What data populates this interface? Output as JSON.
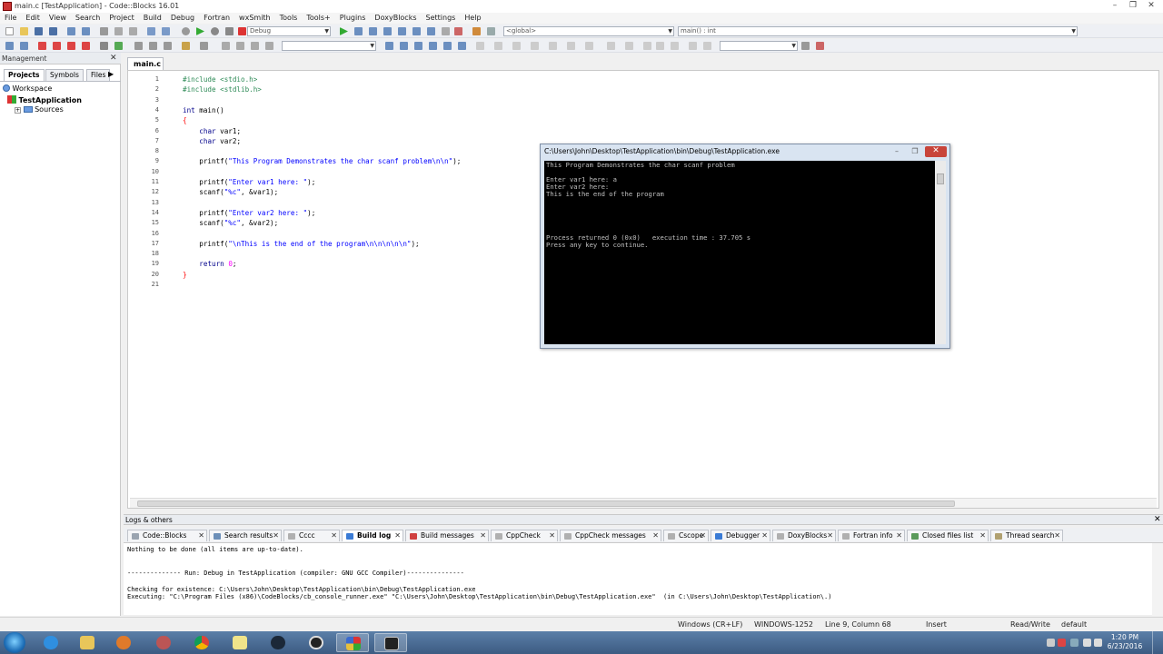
{
  "window": {
    "title": "main.c [TestApplication] - Code::Blocks 16.01"
  },
  "menu": [
    "File",
    "Edit",
    "View",
    "Search",
    "Project",
    "Build",
    "Debug",
    "Fortran",
    "wxSmith",
    "Tools",
    "Tools+",
    "Plugins",
    "DoxyBlocks",
    "Settings",
    "Help"
  ],
  "toolbar": {
    "build_target": "Debug",
    "scope": "<global>",
    "symbol": "main() : int"
  },
  "management": {
    "title": "Management",
    "tabs": [
      "Projects",
      "Symbols",
      "Files"
    ],
    "workspace": "Workspace",
    "project": "TestApplication",
    "folder": "Sources"
  },
  "editor": {
    "tab": "main.c",
    "lines": [
      {
        "n": "1",
        "segments": [
          {
            "c": "pp",
            "t": "#include <stdio.h>"
          }
        ]
      },
      {
        "n": "2",
        "segments": [
          {
            "c": "pp",
            "t": "#include <stdlib.h>"
          }
        ]
      },
      {
        "n": "3",
        "segments": []
      },
      {
        "n": "4",
        "segments": [
          {
            "c": "kw",
            "t": "int"
          },
          {
            "c": "",
            "t": " main()"
          }
        ]
      },
      {
        "n": "5",
        "segments": [
          {
            "c": "br",
            "t": "{"
          }
        ]
      },
      {
        "n": "6",
        "segments": [
          {
            "c": "",
            "t": "    "
          },
          {
            "c": "kw",
            "t": "char"
          },
          {
            "c": "",
            "t": " var1;"
          }
        ]
      },
      {
        "n": "7",
        "segments": [
          {
            "c": "",
            "t": "    "
          },
          {
            "c": "kw",
            "t": "char"
          },
          {
            "c": "",
            "t": " var2;"
          }
        ]
      },
      {
        "n": "8",
        "segments": []
      },
      {
        "n": "9",
        "segments": [
          {
            "c": "",
            "t": "    printf("
          },
          {
            "c": "str",
            "t": "\"This Program Demonstrates the char scanf problem\\n\\n\""
          },
          {
            "c": "",
            "t": ");"
          }
        ]
      },
      {
        "n": "10",
        "segments": []
      },
      {
        "n": "11",
        "segments": [
          {
            "c": "",
            "t": "    printf("
          },
          {
            "c": "str",
            "t": "\"Enter var1 here: \""
          },
          {
            "c": "",
            "t": ");"
          }
        ]
      },
      {
        "n": "12",
        "segments": [
          {
            "c": "",
            "t": "    scanf("
          },
          {
            "c": "str",
            "t": "\"%c\""
          },
          {
            "c": "",
            "t": ", &var1);"
          }
        ]
      },
      {
        "n": "13",
        "segments": []
      },
      {
        "n": "14",
        "segments": [
          {
            "c": "",
            "t": "    printf("
          },
          {
            "c": "str",
            "t": "\"Enter var2 here: \""
          },
          {
            "c": "",
            "t": ");"
          }
        ]
      },
      {
        "n": "15",
        "segments": [
          {
            "c": "",
            "t": "    scanf("
          },
          {
            "c": "str",
            "t": "\"%c\""
          },
          {
            "c": "",
            "t": ", &var2);"
          }
        ]
      },
      {
        "n": "16",
        "segments": []
      },
      {
        "n": "17",
        "segments": [
          {
            "c": "",
            "t": "    printf("
          },
          {
            "c": "str",
            "t": "\"\\nThis is the end of the program\\n\\n\\n\\n\\n\""
          },
          {
            "c": "",
            "t": ");"
          }
        ]
      },
      {
        "n": "18",
        "segments": []
      },
      {
        "n": "19",
        "segments": [
          {
            "c": "",
            "t": "    "
          },
          {
            "c": "kw",
            "t": "return"
          },
          {
            "c": "",
            "t": " "
          },
          {
            "c": "num",
            "t": "0"
          },
          {
            "c": "",
            "t": ";"
          }
        ]
      },
      {
        "n": "20",
        "segments": [
          {
            "c": "br",
            "t": "}"
          }
        ]
      },
      {
        "n": "21",
        "segments": []
      }
    ]
  },
  "console": {
    "title": "C:\\Users\\John\\Desktop\\TestApplication\\bin\\Debug\\TestApplication.exe",
    "text": "This Program Demonstrates the char scanf problem\n\nEnter var1 here: a\nEnter var2 here:\nThis is the end of the program\n\n\n\n\n\nProcess returned 0 (0x0)   execution time : 37.705 s\nPress any key to continue."
  },
  "logs": {
    "title": "Logs & others",
    "tabs": [
      {
        "label": "Code::Blocks",
        "color": "#9aa4b0"
      },
      {
        "label": "Search results",
        "color": "#6c8fb8"
      },
      {
        "label": "Cccc",
        "color": "#b0b0b0"
      },
      {
        "label": "Build log",
        "color": "#3a7bd5"
      },
      {
        "label": "Build messages",
        "color": "#d04040"
      },
      {
        "label": "CppCheck",
        "color": "#b0b0b0"
      },
      {
        "label": "CppCheck messages",
        "color": "#b0b0b0"
      },
      {
        "label": "Cscope",
        "color": "#b0b0b0"
      },
      {
        "label": "Debugger",
        "color": "#3a7bd5"
      },
      {
        "label": "DoxyBlocks",
        "color": "#b0b0b0"
      },
      {
        "label": "Fortran info",
        "color": "#b0b0b0"
      },
      {
        "label": "Closed files list",
        "color": "#5a9a5a"
      },
      {
        "label": "Thread search",
        "color": "#b0a070"
      }
    ],
    "lines": [
      "Nothing to be done (all items are up-to-date).",
      "",
      "",
      "-------------- Run: Debug in TestApplication (compiler: GNU GCC Compiler)---------------",
      "",
      "Checking for existence: C:\\Users\\John\\Desktop\\TestApplication\\bin\\Debug\\TestApplication.exe",
      "Executing: \"C:\\Program Files (x86)\\CodeBlocks/cb_console_runner.exe\" \"C:\\Users\\John\\Desktop\\TestApplication\\bin\\Debug\\TestApplication.exe\"  (in C:\\Users\\John\\Desktop\\TestApplication\\.)"
    ]
  },
  "status": {
    "eol": "Windows (CR+LF)",
    "encoding": "WINDOWS-1252",
    "position": "Line 9, Column 68",
    "mode": "Insert",
    "access": "Read/Write",
    "lang": "default"
  },
  "taskbar": {
    "time": "1:20 PM",
    "date": "6/23/2016"
  }
}
